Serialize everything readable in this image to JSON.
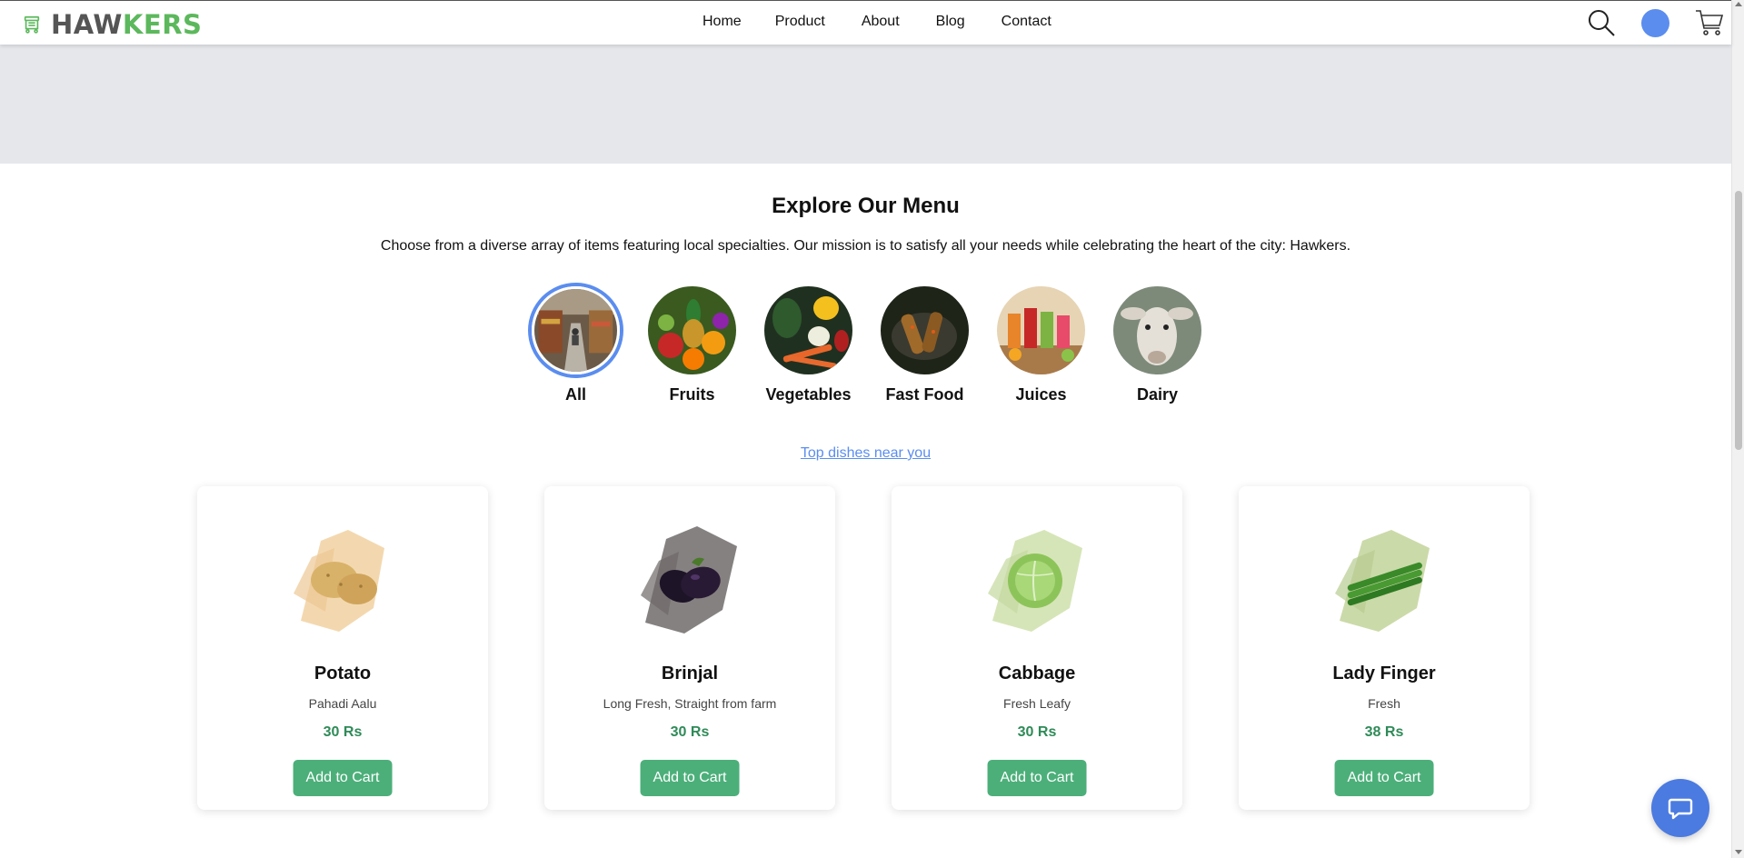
{
  "brand": {
    "name_part1": "HAW",
    "name_part2": "KERS",
    "color_primary": "#5cb85c",
    "color_secondary": "#555555"
  },
  "nav": {
    "links": [
      "Home",
      "Product",
      "About",
      "Blog",
      "Contact"
    ]
  },
  "header_actions": {
    "search_icon": "search-icon",
    "avatar_color": "#5b8def",
    "cart_icon": "cart-icon"
  },
  "menu": {
    "title": "Explore Our Menu",
    "description": "Choose from a diverse array of items featuring local specialties. Our mission is to satisfy all your needs while celebrating the heart of the city: Hawkers.",
    "categories": [
      {
        "label": "All",
        "active": true
      },
      {
        "label": "Fruits",
        "active": false
      },
      {
        "label": "Vegetables",
        "active": false
      },
      {
        "label": "Fast Food",
        "active": false
      },
      {
        "label": "Juices",
        "active": false
      },
      {
        "label": "Dairy",
        "active": false
      }
    ],
    "top_dishes_link": "Top dishes near you"
  },
  "products": [
    {
      "name": "Potato",
      "desc": "Pahadi Aalu",
      "price": "30 Rs",
      "button": "Add to Cart"
    },
    {
      "name": "Brinjal",
      "desc": "Long Fresh, Straight from farm",
      "price": "30 Rs",
      "button": "Add to Cart"
    },
    {
      "name": "Cabbage",
      "desc": "Fresh Leafy",
      "price": "30 Rs",
      "button": "Add to Cart"
    },
    {
      "name": "Lady Finger",
      "desc": "Fresh",
      "price": "38 Rs",
      "button": "Add to Cart"
    }
  ],
  "chat": {
    "icon": "chat-bubble-icon",
    "color": "#4b7be0"
  }
}
